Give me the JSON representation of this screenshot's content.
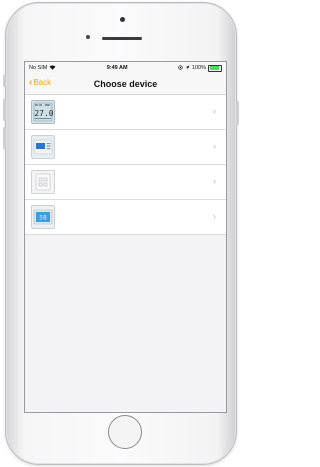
{
  "statusbar": {
    "carrier": "No SIM",
    "wifi_icon": "wifi-icon",
    "time": "9:49 AM",
    "battery_pct": "100%",
    "battery_level": 1.0
  },
  "navbar": {
    "back_label": "Back",
    "title": "Choose device",
    "accent": "#f2a51a"
  },
  "devices": [
    {
      "thumb_icon": "thermostat-lcd-display-icon",
      "screen_text": "27.0"
    },
    {
      "thumb_icon": "thermostat-blue-screen-icon"
    },
    {
      "thumb_icon": "thermostat-white-panel-icon"
    },
    {
      "thumb_icon": "thermostat-blue-panel-icon",
      "screen_text": "58"
    }
  ]
}
